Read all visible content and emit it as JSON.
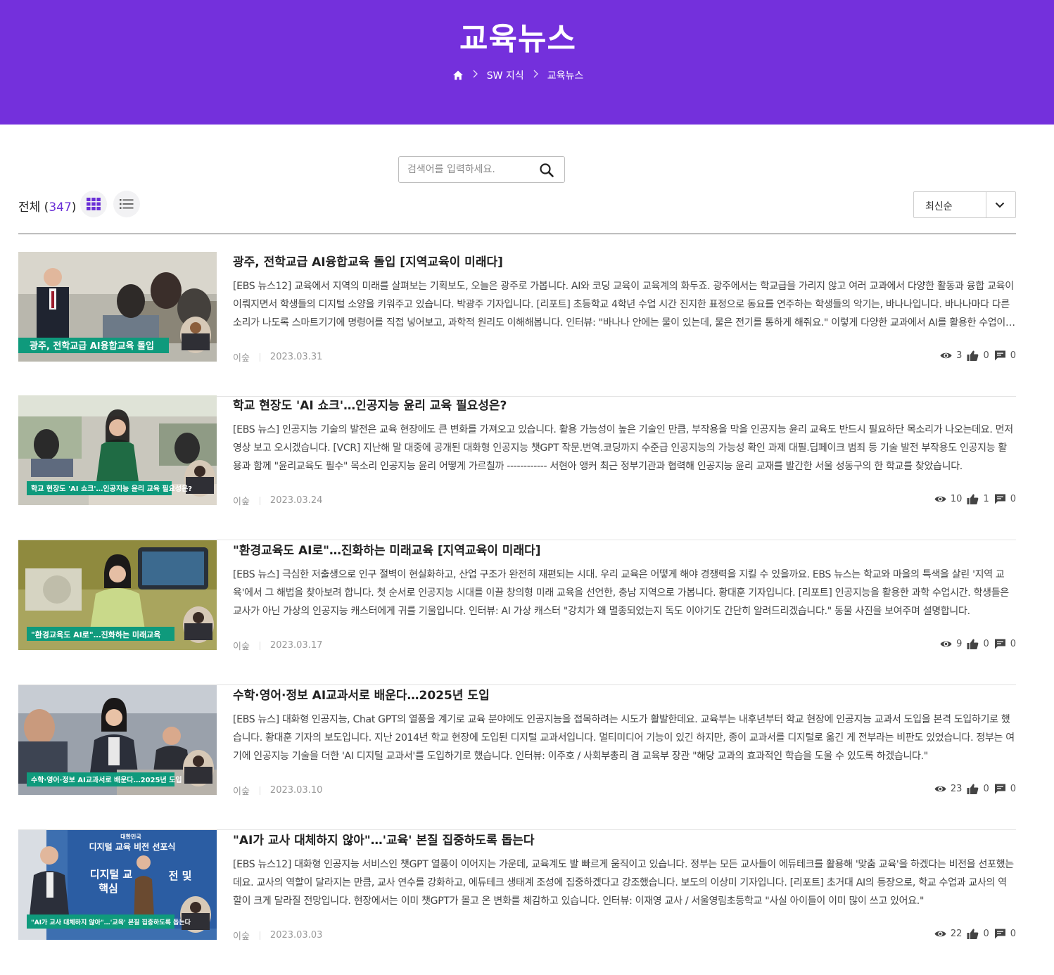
{
  "header": {
    "title": "교육뉴스",
    "breadcrumb": [
      "SW 지식",
      "교육뉴스"
    ]
  },
  "search": {
    "placeholder": "검색어를 입력하세요."
  },
  "toolbar": {
    "total_label": "전체",
    "total_count": "347",
    "sort_value": "최신순"
  },
  "items": [
    {
      "title": "광주, 전학교급 AI융합교육 돌입 [지역교육이 미래다]",
      "desc": "[EBS 뉴스12] 교육에서 지역의 미래를 살펴보는 기획보도, 오늘은 광주로 가봅니다. AI와 코딩 교육이 교육계의 화두죠. 광주에서는 학교급을 가리지 않고 여러 교과에서 다양한 활동과 융합 교육이 이뤄지면서 학생들의 디지털 소양을 키워주고 있습니다. 박광주 기자입니다. [리포트] 초등학교 4학년 수업 시간 진지한 표정으로 동요를 연주하는 학생들의 악기는, 바나나입니다. 바나나마다 다른 소리가 나도록 스마트기기에 명령어를 직접 넣어보고, 과학적 원리도 이해해봅니다. 인터뷰: \"바나나 안에는 물이 있는데, 물은 전기를 통하게 해줘요.\" 이렇게 다양한 교과에서 AI를 활용한 수업이 이뤄지고 있습니다.",
      "caption": "광주, 전학교급 AI융합교육 돌입",
      "author": "이숲",
      "date": "2023.03.31",
      "views": "3",
      "likes": "0",
      "comments": "0"
    },
    {
      "title": "학교 현장도 'AI 쇼크'…인공지능 윤리 교육 필요성은?",
      "desc": "[EBS 뉴스] 인공지능 기술의 발전은 교육 현장에도 큰 변화를 가져오고 있습니다. 활용 가능성이 높은 기술인 만큼, 부작용을 막을 인공지능 윤리 교육도 반드시 필요하단 목소리가 나오는데요. 먼저 영상 보고 오시겠습니다. [VCR] 지난해 말 대중에 공개된 대화형 인공지능 챗GPT 작문.번역.코딩까지 수준급 인공지능의 가능성 확인 과제 대필.딥페이크 범죄 등 기술 발전 부작용도 인공지능 활용과 함께 \"윤리교육도 필수\" 목소리 인공지능 윤리 어떻게 가르칠까 ------------ 서현아 앵커 최근 정부기관과 협력해 인공지능 윤리 교재를 발간한 서울 성동구의 한 학교를 찾았습니다.",
      "caption": "학교 현장도 'AI 쇼크'…인공지능 윤리 교육 필요성은?",
      "author": "이숲",
      "date": "2023.03.24",
      "views": "10",
      "likes": "1",
      "comments": "0"
    },
    {
      "title": "\"환경교육도 AI로\"…진화하는 미래교육 [지역교육이 미래다]",
      "desc": "[EBS 뉴스] 극심한 저출생으로 인구 절벽이 현실화하고, 산업 구조가 완전히 재편되는 시대. 우리 교육은 어떻게 해야 경쟁력을 지킬 수 있을까요. EBS 뉴스는 학교와 마을의 특색을 살린 '지역 교육'에서 그 해법을 찾아보려 합니다. 첫 순서로 인공지능 시대를 이끌 창의형 미래 교육을 선언한, 충남 지역으로 가봅니다. 황대훈 기자입니다. [리포트] 인공지능을 활용한 과학 수업시간. 학생들은 교사가 아닌 가상의 인공지능 캐스터에게 귀를 기울입니다. 인터뷰: AI 가상 캐스터 \"강치가 왜 멸종되었는지 독도 이야기도 간단히 알려드리겠습니다.\" 동물 사진을 보여주며 설명합니다.",
      "caption": "\"환경교육도 AI로\"…진화하는 미래교육",
      "author": "이숲",
      "date": "2023.03.17",
      "views": "9",
      "likes": "0",
      "comments": "0"
    },
    {
      "title": "수학·영어·정보 AI교과서로 배운다…2025년 도입",
      "desc": "[EBS 뉴스] 대화형 인공지능, Chat GPT의 열풍을 계기로 교육 분야에도 인공지능을 접목하려는 시도가 활발한데요. 교육부는 내후년부터 학교 현장에 인공지능 교과서 도입을 본격 도입하기로 했습니다. 황대훈 기자의 보도입니다. 지난 2014년 학교 현장에 도입된 디지털 교과서입니다. 멀티미디어 기능이 있긴 하지만, 종이 교과서를 디지털로 옮긴 게 전부라는 비판도 있었습니다. 정부는 여기에 인공지능 기술을 더한 'AI 디지털 교과서'를 도입하기로 했습니다. 인터뷰: 이주호 / 사회부총리 겸 교육부 장관 \"해당 교과의 효과적인 학습을 도울 수 있도록 하겠습니다.\"",
      "caption": "수학·영어·정보 AI교과서로 배운다…2025년 도입",
      "author": "이숲",
      "date": "2023.03.10",
      "views": "23",
      "likes": "0",
      "comments": "0"
    },
    {
      "title": "\"AI가 교사 대체하지 않아\"…'교육' 본질 집중하도록 돕는다",
      "desc": "[EBS 뉴스12] 대화형 인공지능 서비스인 챗GPT 열풍이 이어지는 가운데, 교육계도 발 빠르게 움직이고 있습니다. 정부는 모든 교사들이 에듀테크를 활용해 '맞춤 교육'을 하겠다는 비전을 선포했는데요. 교사의 역할이 달라지는 만큼, 교사 연수를 강화하고, 에듀테크 생태계 조성에 집중하겠다고 강조했습니다. 보도의 이상미 기자입니다. [리포트] 초거대 AI의 등장으로, 학교 수업과 교사의 역할이 크게 달라질 전망입니다. 현장에서는 이미 챗GPT가 몰고 온 변화를 체감하고 있습니다. 인터뷰: 이재영 교사 / 서울영림초등학교 \"사실 아이들이 이미 많이 쓰고 있어요.\"",
      "caption": "\"AI가 교사 대체하지 않아\"…'교육' 본질 집중하도록 돕는다",
      "author": "이숲",
      "date": "2023.03.03",
      "views": "22",
      "likes": "0",
      "comments": "0"
    }
  ],
  "thumb_overlays": {
    "item5_banner_line1": "대한민국",
    "item5_banner_line2": "디지털 교육 비전 선포식",
    "item5_banner_line3": "디지털 교",
    "item5_banner_line4": "전 및",
    "item5_banner_line5": "핵심"
  },
  "colors": {
    "hero_bg": "#7430dc",
    "accent": "#6a2fd6",
    "caption_bg": "#0f9a7c"
  },
  "icons": [
    "home-icon",
    "chevron-right-icon",
    "search-icon",
    "grid-view-icon",
    "list-view-icon",
    "chevron-down-icon",
    "eye-icon",
    "thumbs-up-icon",
    "comment-icon"
  ]
}
